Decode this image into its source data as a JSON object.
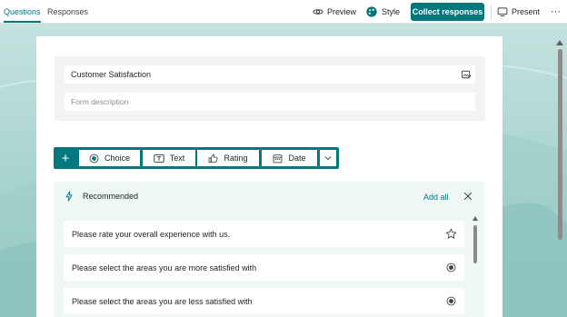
{
  "tabs": [
    {
      "label": "Questions",
      "active": true
    },
    {
      "label": "Responses",
      "active": false
    }
  ],
  "toolbar": {
    "preview_label": "Preview",
    "style_label": "Style",
    "collect_label": "Collect responses",
    "present_label": "Present",
    "more_label": "···"
  },
  "form": {
    "title": "Customer Satisfaction",
    "description_placeholder": "Form description"
  },
  "question_types": {
    "choice": "Choice",
    "text": "Text",
    "rating": "Rating",
    "date": "Date"
  },
  "recommended": {
    "title": "Recommended",
    "add_all": "Add all",
    "items": [
      {
        "label": "Please rate your overall experience with us.",
        "icon": "star-icon"
      },
      {
        "label": "Please select the areas you are more satisfied with",
        "icon": "radio-icon"
      },
      {
        "label": "Please select the areas you are less satisfied with",
        "icon": "radio-icon"
      }
    ]
  },
  "colors": {
    "accent": "#03787c",
    "background": "#a9d4cf"
  }
}
